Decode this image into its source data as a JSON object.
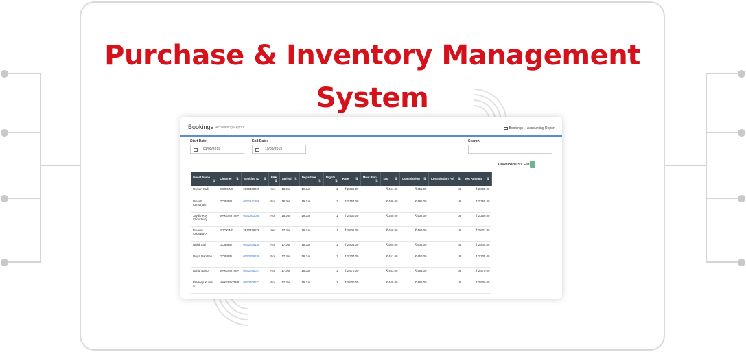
{
  "headline": "Purchase & Inventory Management System",
  "colors": {
    "accent": "#d4121c",
    "table_header": "#3a4650",
    "link": "#3b7bbf"
  },
  "app": {
    "title": "Bookings",
    "subtitle": "Accounting Report",
    "breadcrumb": [
      "Bookings",
      "Accounting Report"
    ],
    "breadcrumb_icon": "dashboard-icon",
    "filters": {
      "start_label": "Start Date:",
      "start_value": "01/05/2019",
      "end_label": "End Date:",
      "end_value": "19/06/2019",
      "search_label": "Search:",
      "search_value": ""
    },
    "download_label": "Download CSV File",
    "download_icon": "csv-file-icon",
    "columns": [
      "Guest Name",
      "Channel",
      "Booking ID",
      "PAH",
      "Arrival",
      "Departure",
      "Nights",
      "Rate",
      "Meal Plan",
      "Tax",
      "Commission",
      "Commission (%)",
      "Net Amount"
    ],
    "rows": [
      [
        "Usman Kadi",
        "BOOKING",
        "2109438760",
        "Yes",
        "18 Jun",
        "19 Jun",
        "1",
        "₹ 2,305.00",
        "",
        "₹ 451.00",
        "₹ 451.00",
        "18",
        "₹ 2,305.00"
      ],
      [
        "Dinesh Kumarjain",
        "GOIBIBO",
        "0052241398",
        "No",
        "18 Jun",
        "19 Jun",
        "1",
        "₹ 2,754.00",
        "",
        "₹ 496.00",
        "₹ 495.00",
        "18",
        "₹ 2,755.00"
      ],
      [
        "Jaydip Roy Choudhury",
        "MAKEMYTRIP",
        "0051863048",
        "No",
        "18 Jun",
        "19 Jun",
        "1",
        "₹ 2,400.00",
        "",
        "₹ 288.00",
        "₹ 432.00",
        "18",
        "₹ 2,256.00"
      ],
      [
        "Naveen CHANDRA",
        "BOOKING",
        "2670378676",
        "Yes",
        "17 Jun",
        "18 Jun",
        "1",
        "₹ 2,601.00",
        "",
        "₹ 468.00",
        "₹ 468.00",
        "18",
        "₹ 2,601.00"
      ],
      [
        "Nikhil Suri",
        "GOIBIBO",
        "0052255146",
        "No",
        "17 Jun",
        "18 Jun",
        "1",
        "₹ 2,804.00",
        "",
        "₹ 505.00",
        "₹ 504.00",
        "18",
        "₹ 2,805.00"
      ],
      [
        "Divya Darshan",
        "GOIBIBO",
        "0052256636",
        "No",
        "17 Jun",
        "18 Jun",
        "1",
        "₹ 2,304.00",
        "",
        "₹ 451.00",
        "₹ 450.00",
        "18",
        "₹ 2,305.00"
      ],
      [
        "Rahul Nanoi",
        "MAKEMYTRIP",
        "0052045021",
        "No",
        "17 Jun",
        "18 Jun",
        "1",
        "₹ 2,570.00",
        "",
        "₹ 463.00",
        "₹ 463.00",
        "18",
        "₹ 2,570.00"
      ],
      [
        "Pradeep Kumar S",
        "MAKEMYTRIP",
        "0052208573",
        "No",
        "17 Jun",
        "18 Jun",
        "1",
        "₹ 2,600.00",
        "",
        "₹ 468.00",
        "₹ 468.00",
        "18",
        "₹ 2,600.00"
      ]
    ],
    "link_column": 2,
    "link_rows": [
      1,
      2,
      4,
      5,
      6,
      7
    ]
  }
}
